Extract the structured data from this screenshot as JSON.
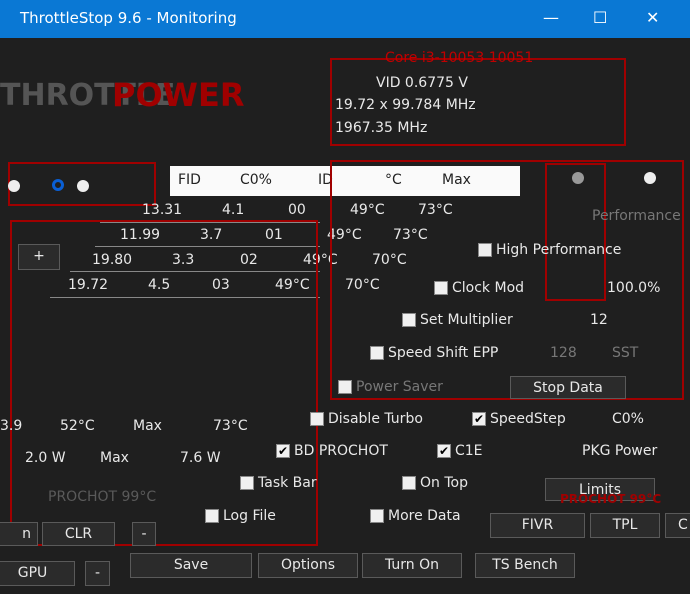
{
  "window": {
    "title": "ThrottleStop 9.6 - Monitoring",
    "minimize": "—",
    "maximize": "☐",
    "close": "✕"
  },
  "logo": {
    "left": "THROTTLE",
    "right": "POWER"
  },
  "core": {
    "title": "Core i3-10053 10051",
    "vid": "VID 0.6775 V",
    "multiplier": "19.72 x 99.784 MHz",
    "freq": "1967.35 MHz"
  },
  "table": {
    "headers": [
      "FID",
      "C0%",
      "ID",
      "°C",
      "Max"
    ],
    "rows": [
      [
        "13.31",
        "4.1",
        "00",
        "49°C",
        "73°C"
      ],
      [
        "11.99",
        "3.7",
        "01",
        "49°C",
        "73°C"
      ],
      [
        "19.80",
        "3.3",
        "02",
        "49°C",
        "70°C"
      ],
      [
        "19.72",
        "4.5",
        "03",
        "49°C",
        "70°C"
      ]
    ]
  },
  "left": {
    "plus": "+",
    "c0": "3.9",
    "temp": "52°C",
    "max_label": "Max",
    "max_temp": "73°C",
    "power": "2.0 W",
    "power_max_label": "Max",
    "power_max": "7.6 W",
    "prochot": "PROCHOT 99°C"
  },
  "profiles": {
    "label": "Performance"
  },
  "options": {
    "high_performance": {
      "label": "High Performance",
      "checked": false
    },
    "clock_mod": {
      "label": "Clock Mod",
      "checked": false,
      "value": "100.0%"
    },
    "set_multiplier": {
      "label": "Set Multiplier",
      "checked": false,
      "value": "12"
    },
    "speed_shift": {
      "label": "Speed Shift EPP",
      "checked": false,
      "value": "128",
      "extra": "SST"
    },
    "power_saver": {
      "label": "Power Saver",
      "checked": false
    },
    "disable_turbo": {
      "label": "Disable Turbo",
      "checked": false
    },
    "speedstep": {
      "label": "SpeedStep",
      "checked": true
    },
    "bd_prochot": {
      "label": "BD PROCHOT",
      "checked": true
    },
    "c1e": {
      "label": "C1E",
      "checked": true
    },
    "task_bar": {
      "label": "Task Bar",
      "checked": false
    },
    "on_top": {
      "label": "On Top",
      "checked": false
    },
    "log_file": {
      "label": "Log File",
      "checked": false
    },
    "more_data": {
      "label": "More Data",
      "checked": false
    }
  },
  "right": {
    "c0": "C0%",
    "pkg_power": "PKG Power",
    "prochot": "PROCHOT 99°C"
  },
  "buttons": {
    "stop_data": "Stop Data",
    "limits": "Limits",
    "fivr": "FIVR",
    "tpl": "TPL",
    "c": "C",
    "on": "n",
    "clr": "CLR",
    "minus": "-",
    "gpu": "GPU",
    "minus2": "-",
    "save": "Save",
    "options": "Options",
    "turn_on": "Turn On",
    "ts_bench": "TS Bench"
  },
  "colors": {
    "accent": "#0a78d4",
    "red": "#a00000"
  }
}
